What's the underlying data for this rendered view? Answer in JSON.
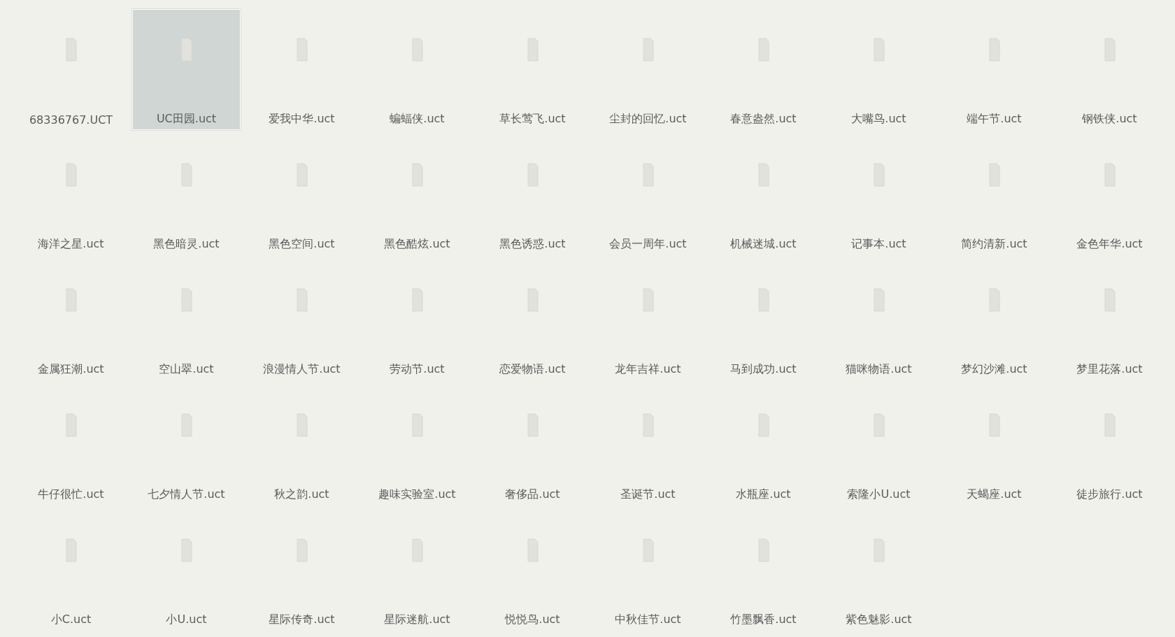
{
  "files": [
    {
      "name": "68336767.UCT",
      "selected": false
    },
    {
      "name": "UC田园.uct",
      "selected": true
    },
    {
      "name": "爱我中华.uct",
      "selected": false
    },
    {
      "name": "蝙蝠侠.uct",
      "selected": false
    },
    {
      "name": "草长莺飞.uct",
      "selected": false
    },
    {
      "name": "尘封的回忆.uct",
      "selected": false
    },
    {
      "name": "春意盎然.uct",
      "selected": false
    },
    {
      "name": "大嘴鸟.uct",
      "selected": false
    },
    {
      "name": "端午节.uct",
      "selected": false
    },
    {
      "name": "钢铁侠.uct",
      "selected": false
    },
    {
      "name": "海洋之星.uct",
      "selected": false
    },
    {
      "name": "黑色暗灵.uct",
      "selected": false
    },
    {
      "name": "黑色空间.uct",
      "selected": false
    },
    {
      "name": "黑色酷炫.uct",
      "selected": false
    },
    {
      "name": "黑色诱惑.uct",
      "selected": false
    },
    {
      "name": "会员一周年.uct",
      "selected": false
    },
    {
      "name": "机械迷城.uct",
      "selected": false
    },
    {
      "name": "记事本.uct",
      "selected": false
    },
    {
      "name": "简约清新.uct",
      "selected": false
    },
    {
      "name": "金色年华.uct",
      "selected": false
    },
    {
      "name": "金属狂潮.uct",
      "selected": false
    },
    {
      "name": "空山翠.uct",
      "selected": false
    },
    {
      "name": "浪漫情人节.uct",
      "selected": false
    },
    {
      "name": "劳动节.uct",
      "selected": false
    },
    {
      "name": "恋爱物语.uct",
      "selected": false
    },
    {
      "name": "龙年吉祥.uct",
      "selected": false
    },
    {
      "name": "马到成功.uct",
      "selected": false
    },
    {
      "name": "猫咪物语.uct",
      "selected": false
    },
    {
      "name": "梦幻沙滩.uct",
      "selected": false
    },
    {
      "name": "梦里花落.uct",
      "selected": false
    },
    {
      "name": "牛仔很忙.uct",
      "selected": false
    },
    {
      "name": "七夕情人节.uct",
      "selected": false
    },
    {
      "name": "秋之韵.uct",
      "selected": false
    },
    {
      "name": "趣味实验室.uct",
      "selected": false
    },
    {
      "name": "奢侈品.uct",
      "selected": false
    },
    {
      "name": "圣诞节.uct",
      "selected": false
    },
    {
      "name": "水瓶座.uct",
      "selected": false
    },
    {
      "name": "索隆小U.uct",
      "selected": false
    },
    {
      "name": "天蝎座.uct",
      "selected": false
    },
    {
      "name": "徒步旅行.uct",
      "selected": false
    },
    {
      "name": "小C.uct",
      "selected": false
    },
    {
      "name": "小U.uct",
      "selected": false
    },
    {
      "name": "星际传奇.uct",
      "selected": false
    },
    {
      "name": "星际迷航.uct",
      "selected": false
    },
    {
      "name": "悦悦鸟.uct",
      "selected": false
    },
    {
      "name": "中秋佳节.uct",
      "selected": false
    },
    {
      "name": "竹墨飘香.uct",
      "selected": false
    },
    {
      "name": "紫色魅影.uct",
      "selected": false
    }
  ]
}
